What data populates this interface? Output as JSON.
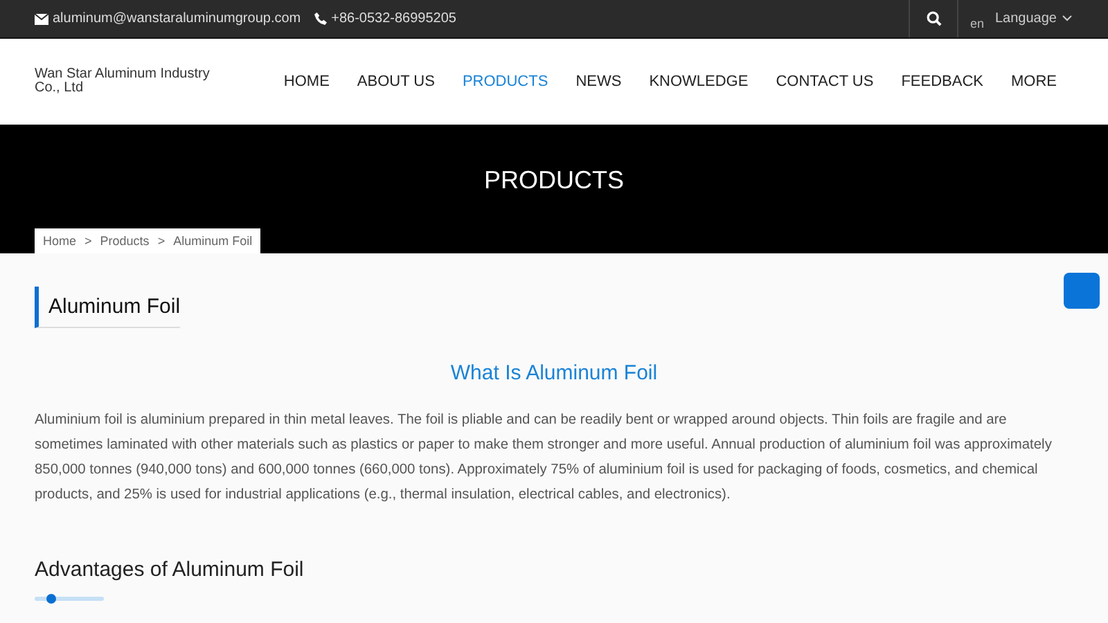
{
  "top_bar": {
    "email": "aluminum@wanstaraluminumgroup.com",
    "phone": "+86-0532-86995205",
    "language_code": "en",
    "language_label": "Language"
  },
  "header": {
    "company": "Wan Star Aluminum Industry Co., Ltd",
    "nav": [
      {
        "label": "HOME",
        "selected": false
      },
      {
        "label": "ABOUT US",
        "selected": false
      },
      {
        "label": "PRODUCTS",
        "selected": true
      },
      {
        "label": "NEWS",
        "selected": false
      },
      {
        "label": "KNOWLEDGE",
        "selected": false
      },
      {
        "label": "CONTACT US",
        "selected": false
      },
      {
        "label": "FEEDBACK",
        "selected": false
      },
      {
        "label": "MORE",
        "selected": false
      }
    ]
  },
  "banner": {
    "title": "PRODUCTS",
    "breadcrumb": [
      "Home",
      "Products",
      "Aluminum Foil"
    ],
    "separator": ">"
  },
  "content": {
    "heading": "Aluminum Foil",
    "section_title": "What Is Aluminum Foil",
    "paragraph": "Aluminium foil is aluminium prepared in thin metal leaves. The foil is pliable and can be readily bent or wrapped around objects. Thin foils are fragile and are sometimes laminated with other materials such as plastics or paper to make them stronger and more useful. Annual production of aluminium foil was approximately 850,000 tonnes (940,000 tons) and 600,000 tonnes (660,000 tons). Approximately 75% of aluminium foil is used for packaging of foods, cosmetics, and chemical products, and 25% is used for industrial applications (e.g., thermal insulation, electrical cables, and electronics).",
    "subheading": "Advantages of Aluminum Foil"
  }
}
